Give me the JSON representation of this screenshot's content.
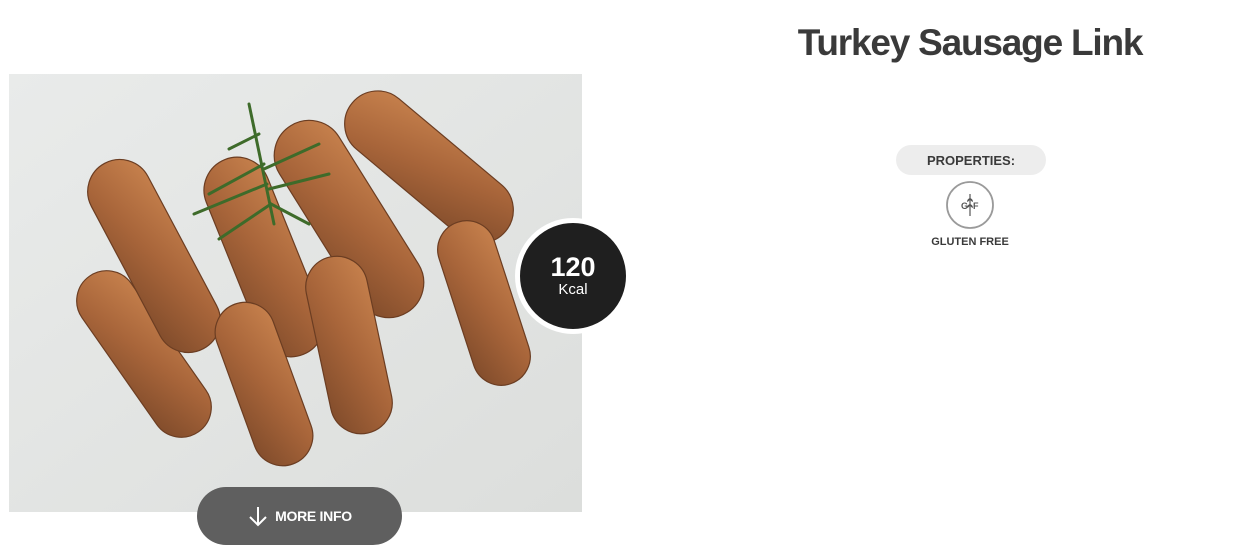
{
  "product": {
    "title": "Turkey Sausage Link",
    "photo_alt": "turkey-sausage-photo"
  },
  "calories": {
    "value": "120",
    "unit": "Kcal"
  },
  "more_info": {
    "label": "MORE INFO",
    "icon": "arrow-down-icon"
  },
  "properties": {
    "heading": "PROPERTIES:",
    "items": [
      {
        "icon": "gluten-free-icon",
        "icon_text_left": "G",
        "icon_text_right": "F",
        "label": "GLUTEN FREE"
      }
    ]
  },
  "colors": {
    "badge": "#1f1f1f",
    "button": "#5f5f5f",
    "title": "#3a3a3a",
    "pill": "#ededed"
  }
}
